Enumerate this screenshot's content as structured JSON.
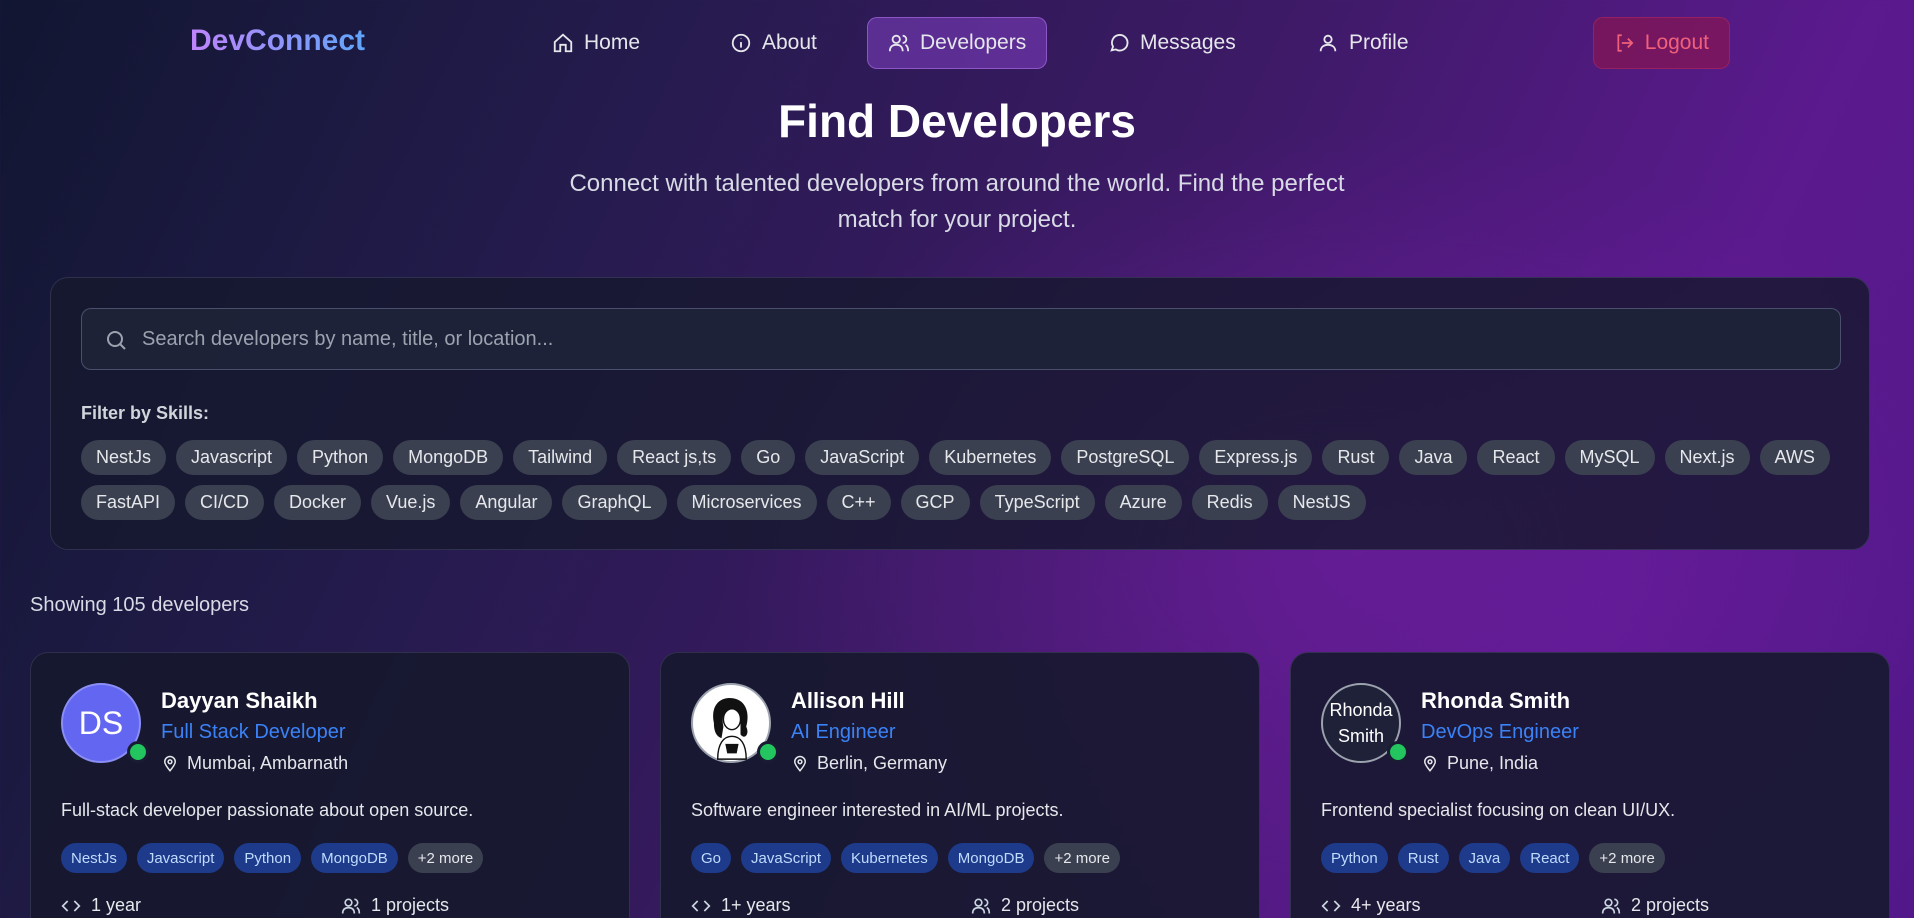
{
  "nav": {
    "brand": "DevConnect",
    "items": [
      {
        "label": "Home",
        "icon": "home-icon"
      },
      {
        "label": "About",
        "icon": "info-icon"
      },
      {
        "label": "Developers",
        "icon": "users-icon",
        "active": true
      },
      {
        "label": "Messages",
        "icon": "message-icon"
      },
      {
        "label": "Profile",
        "icon": "user-icon"
      }
    ],
    "logout_label": "Logout"
  },
  "hero": {
    "title": "Find Developers",
    "subtitle": "Connect with talented developers from around the world. Find the perfect match for your project."
  },
  "search": {
    "placeholder": "Search developers by name, title, or location...",
    "value": ""
  },
  "filters": {
    "label": "Filter by Skills:",
    "skills": [
      "NestJs",
      "Javascript",
      "Python",
      "MongoDB",
      "Tailwind",
      "React js,ts",
      "Go",
      "JavaScript",
      "Kubernetes",
      "PostgreSQL",
      "Express.js",
      "Rust",
      "Java",
      "React",
      "MySQL",
      "Next.js",
      "AWS",
      "FastAPI",
      "CI/CD",
      "Docker",
      "Vue.js",
      "Angular",
      "GraphQL",
      "Microservices",
      "C++",
      "GCP",
      "TypeScript",
      "Azure",
      "Redis",
      "NestJS"
    ]
  },
  "results": {
    "showing_text": "Showing 105 developers"
  },
  "developers": [
    {
      "initials": "DS",
      "name": "Dayyan Shaikh",
      "title": "Full Stack Developer",
      "location": "Mumbai, Ambarnath",
      "bio": "Full-stack developer passionate about open source.",
      "tags": [
        "NestJs",
        "Javascript",
        "Python",
        "MongoDB"
      ],
      "more": "+2 more",
      "experience": "1 year",
      "projects": "1 projects"
    },
    {
      "initials": "",
      "name": "Allison Hill",
      "title": "AI Engineer",
      "location": "Berlin, Germany",
      "bio": "Software engineer interested in AI/ML projects.",
      "tags": [
        "Go",
        "JavaScript",
        "Kubernetes",
        "MongoDB"
      ],
      "more": "+2 more",
      "experience": "1+ years",
      "projects": "2 projects"
    },
    {
      "initials": "Rhonda Smith",
      "name": "Rhonda Smith",
      "title": "DevOps Engineer",
      "location": "Pune, India",
      "bio": "Frontend specialist focusing on clean UI/UX.",
      "tags": [
        "Python",
        "Rust",
        "Java",
        "React"
      ],
      "more": "+2 more",
      "experience": "4+ years",
      "projects": "2 projects"
    }
  ],
  "colors": {
    "accent": "#3b82f6",
    "online": "#22c55e",
    "logout": "#f0607a"
  }
}
